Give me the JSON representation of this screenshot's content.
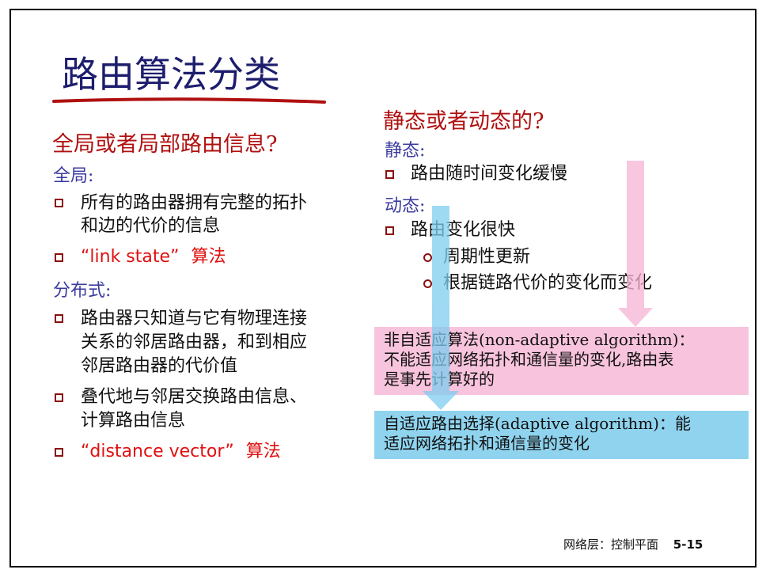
{
  "title": "路由算法分类",
  "left": {
    "heading": "全局或者局部路由信息?",
    "global_label": "全局:",
    "global_item1_line1": "所有的路由器拥有完整的拓扑",
    "global_item1_line2": "和边的代价的信息",
    "global_item2_quote": "“link state”",
    "global_item2_suffix": "算法",
    "distributed_label": "分布式:",
    "dist_item1_line1": "路由器只知道与它有物理连接",
    "dist_item1_line2": "关系的邻居路由器，和到相应",
    "dist_item1_line3": "邻居路由器的代价值",
    "dist_item2_line1": "叠代地与邻居交换路由信息、",
    "dist_item2_line2": "计算路由信息",
    "dist_item3_quote": "“distance vector”",
    "dist_item3_suffix": "算法"
  },
  "right": {
    "heading": "静态或者动态的?",
    "static_label": "静态:",
    "static_item1": "路由随时间变化缓慢",
    "dynamic_label": "动态:",
    "dynamic_item1": "路由变化很快",
    "dynamic_sub1": "周期性更新",
    "dynamic_sub2": "根据链路代价的变化而变化",
    "pink_box_line1": "非自适应算法(non-adaptive algorithm)：",
    "pink_box_line2": "不能适应网络拓扑和通信量的变化,路由表",
    "pink_box_line3": "是事先计算好的",
    "blue_box_line1": "自适应路由选择(adaptive algorithm)：能",
    "blue_box_line2": "适应网络拓扑和通信量的变化"
  },
  "footer": {
    "section": "网络层：控制平面",
    "page": "5-15"
  },
  "colors": {
    "title": "#1d1d6e",
    "heading_red": "#b01010",
    "label_blue": "#3b3b9e",
    "keyword_red": "#e01010",
    "pink": "#f8c3dc",
    "blue": "#8fd3ee",
    "arrow_pink": "#f6b3d3",
    "arrow_blue": "#7fcdef"
  }
}
